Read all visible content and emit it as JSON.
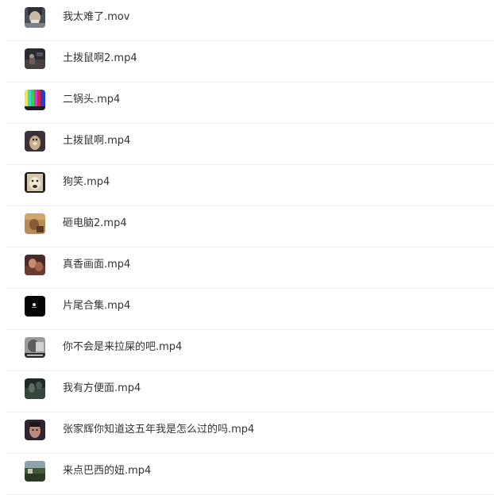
{
  "files": [
    {
      "name": "我太难了.mov",
      "thumb": "person-closeup-thumbnail"
    },
    {
      "name": "土拨鼠啊2.mp4",
      "thumb": "dark-scene-thumbnail"
    },
    {
      "name": "二锅头.mp4",
      "thumb": "color-bars-thumbnail"
    },
    {
      "name": "土拨鼠啊.mp4",
      "thumb": "groundhog-thumbnail"
    },
    {
      "name": "狗笑.mp4",
      "thumb": "dog-thumbnail"
    },
    {
      "name": "砸电脑2.mp4",
      "thumb": "warm-scene-thumbnail"
    },
    {
      "name": "真香画面.mp4",
      "thumb": "movie-still-thumbnail"
    },
    {
      "name": "片尾合集.mp4",
      "thumb": "black-frame-thumbnail"
    },
    {
      "name": "你不会是来拉屎的吧.mp4",
      "thumb": "grayscale-caption-thumbnail"
    },
    {
      "name": "我有方便面.mp4",
      "thumb": "dark-green-thumbnail"
    },
    {
      "name": "张家辉你知道这五年我是怎么过的吗.mp4",
      "thumb": "portrait-thumbnail"
    },
    {
      "name": "来点巴西的妞.mp4",
      "thumb": "landscape-thumbnail"
    }
  ]
}
